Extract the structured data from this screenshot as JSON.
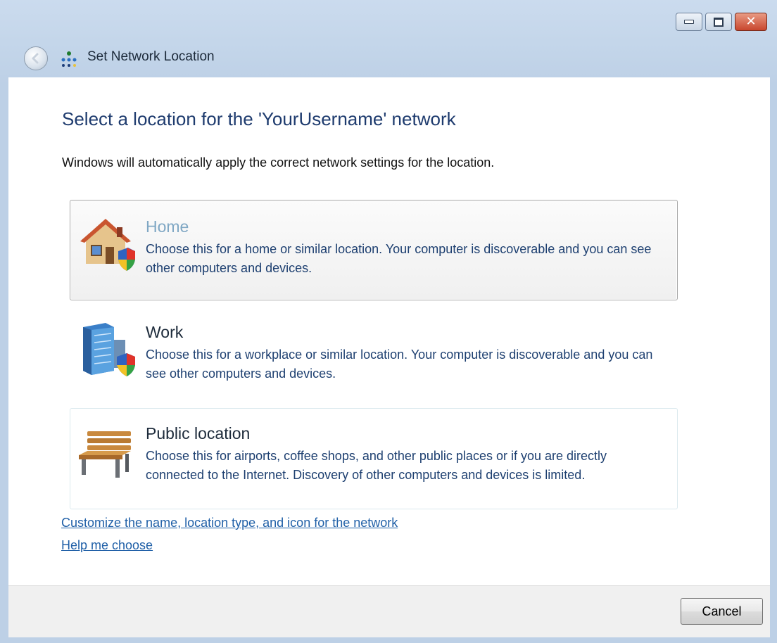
{
  "window": {
    "title": "Set Network Location",
    "icons": {
      "back": "back-arrow-icon",
      "network": "network-icon",
      "minimize": "minimize-icon",
      "maximize": "maximize-icon",
      "close": "close-icon"
    }
  },
  "content": {
    "heading": "Select a location for the 'YourUsername' network",
    "subtext": "Windows will automatically apply the correct network settings for the location."
  },
  "options": [
    {
      "title": "Home",
      "description": "Choose this for a home or similar location. Your computer is discoverable and you can see other computers and devices.",
      "icon": "home-icon"
    },
    {
      "title": "Work",
      "description": "Choose this for a workplace or similar location. Your computer is discoverable and you can see other computers and devices.",
      "icon": "work-building-icon"
    },
    {
      "title": "Public location",
      "description": "Choose this for airports, coffee shops, and other public places or if you are directly connected to the Internet. Discovery of other computers and devices is limited.",
      "icon": "park-bench-icon"
    }
  ],
  "links": {
    "customize": "Customize the name, location type, and icon for the network",
    "help": "Help me choose"
  },
  "footer": {
    "cancel_label": "Cancel"
  },
  "colors": {
    "heading": "#1e3b6e",
    "description": "#1d3f70",
    "link": "#1f5fa7",
    "hover_title": "#7fa7c4"
  }
}
